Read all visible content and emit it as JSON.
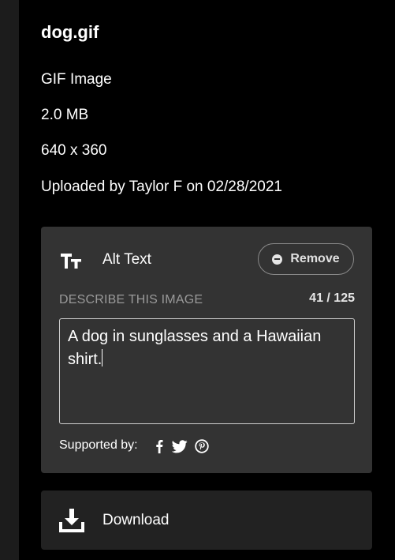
{
  "file": {
    "name": "dog.gif",
    "type": "GIF Image",
    "size": "2.0 MB",
    "dimensions": "640 x 360",
    "uploaded": "Uploaded by Taylor F on 02/28/2021"
  },
  "alt_text": {
    "title": "Alt Text",
    "remove_label": "Remove",
    "describe_label": "DESCRIBE THIS IMAGE",
    "char_count": "41 / 125",
    "value": "A dog in sunglasses and a Hawaiian shirt.",
    "supported_label": "Supported by:",
    "supported_icons": [
      "facebook-icon",
      "twitter-icon",
      "pinterest-icon"
    ]
  },
  "download": {
    "label": "Download"
  },
  "colors": {
    "background": "#000000",
    "card": "#333333",
    "download_card": "#222222",
    "muted_text": "#9a9a9a"
  }
}
